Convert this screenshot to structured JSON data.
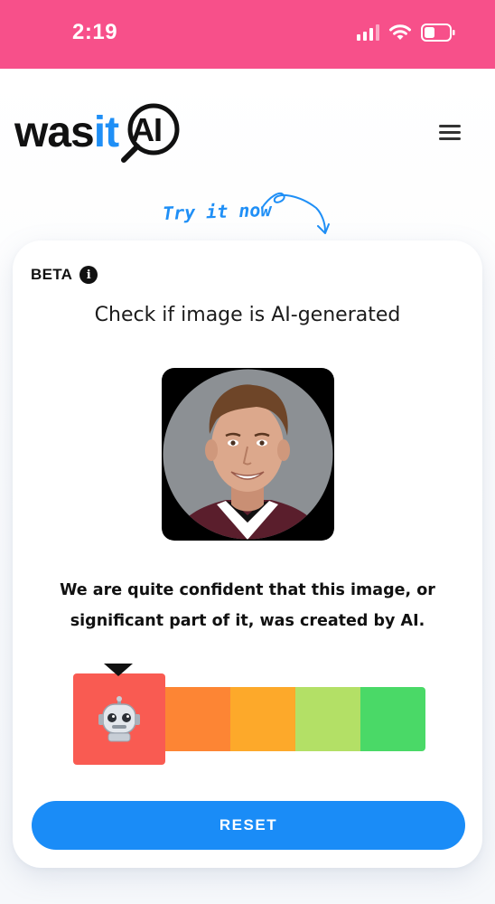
{
  "status_bar": {
    "time": "2:19",
    "background_color": "#f7508a",
    "icons": [
      "signal-icon",
      "wifi-icon",
      "battery-icon"
    ]
  },
  "header": {
    "logo": {
      "part1": "was",
      "part2": "it",
      "part3": "AI"
    },
    "menu_icon": "menu-icon"
  },
  "promo": {
    "try_it": "Try it now"
  },
  "card": {
    "beta_label": "BETA",
    "info_icon": "info-icon",
    "title": "Check if image is AI-generated",
    "image": "portrait-photo",
    "verdict": "We are quite confident that this image, or significant part of it, was created by AI.",
    "meter": {
      "segment_colors": [
        "#f95b52",
        "#fd8534",
        "#fda92a",
        "#b3e066",
        "#4ad967"
      ],
      "active_segment": 0,
      "active_icon": "robot-icon"
    },
    "reset_label": "RESET"
  },
  "colors": {
    "accent": "#1a8cf7",
    "brand_blue": "#1f8ff6"
  }
}
